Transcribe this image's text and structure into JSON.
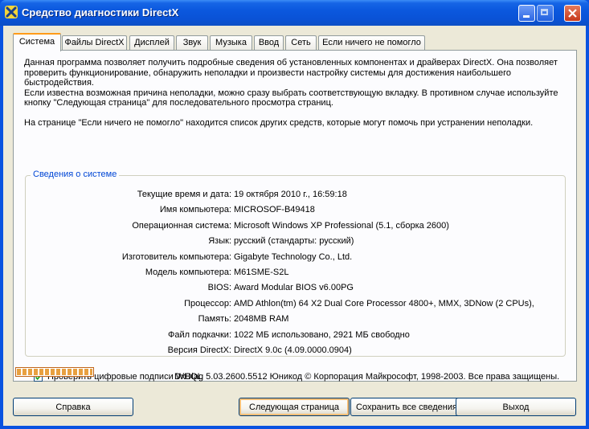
{
  "window": {
    "title": "Средство диагностики DirectX",
    "controls": [
      "minimize-icon",
      "maximize-icon",
      "close-icon"
    ]
  },
  "tabs": [
    {
      "label": "Система",
      "active": true
    },
    {
      "label": "Файлы DirectX",
      "active": false
    },
    {
      "label": "Дисплей",
      "active": false
    },
    {
      "label": "Звук",
      "active": false
    },
    {
      "label": "Музыка",
      "active": false
    },
    {
      "label": "Ввод",
      "active": false
    },
    {
      "label": "Сеть",
      "active": false
    },
    {
      "label": "Если ничего не помогло",
      "active": false
    }
  ],
  "intro": {
    "p1": "Данная программа позволяет получить подробные сведения об установленных компонентах и драйверах DirectX. Она позволяет проверить функционирование, обнаружить неполадки и произвести настройку системы для достижения наибольшего быстродействия.",
    "p2": "Если известна возможная причина неполадки, можно сразу выбрать соответствующую вкладку. В противном случае используйте кнопку \"Следующая страница\" для последовательного просмотра страниц.",
    "p3": "На странице \"Если ничего не помогло\" находится список других средств, которые могут помочь при устранении неполадки."
  },
  "system_info": {
    "title": "Сведения о системе",
    "rows": [
      {
        "label": "Текущие время и дата:",
        "value": "19 октября 2010 г., 16:59:18"
      },
      {
        "label": "Имя компьютера:",
        "value": "MICROSOF-B49418"
      },
      {
        "label": "Операционная система:",
        "value": "Microsoft Windows XP Professional (5.1, сборка 2600)"
      },
      {
        "label": "Язык:",
        "value": "русский (стандарты: русский)"
      },
      {
        "label": "Изготовитель компьютера:",
        "value": "Gigabyte Technology Co., Ltd."
      },
      {
        "label": "Модель компьютера:",
        "value": "M61SME-S2L"
      },
      {
        "label": "BIOS:",
        "value": "Award Modular BIOS v6.00PG"
      },
      {
        "label": "Процессор:",
        "value": "AMD Athlon(tm) 64 X2 Dual Core Processor 4800+,  MMX,  3DNow (2 CPUs),"
      },
      {
        "label": "Память:",
        "value": "2048MB RAM"
      },
      {
        "label": "Файл подкачки:",
        "value": "1022 МБ использовано, 2921 МБ свободно"
      },
      {
        "label": "Версия DirectX:",
        "value": "DirectX 9.0c (4.09.0000.0904)"
      }
    ]
  },
  "whql_check": {
    "label": "Проверить цифровые подписи WHQL",
    "checked": true
  },
  "progress": {
    "fraction": 1.0
  },
  "copyright": "DxDiag 5.03.2600.5512 Юникод  © Корпорация Майкрософт, 1998-2003.  Все права защищены.",
  "buttons": {
    "help": "Справка",
    "next": "Следующая страница",
    "save": "Сохранить все сведения...",
    "exit": "Выход"
  }
}
